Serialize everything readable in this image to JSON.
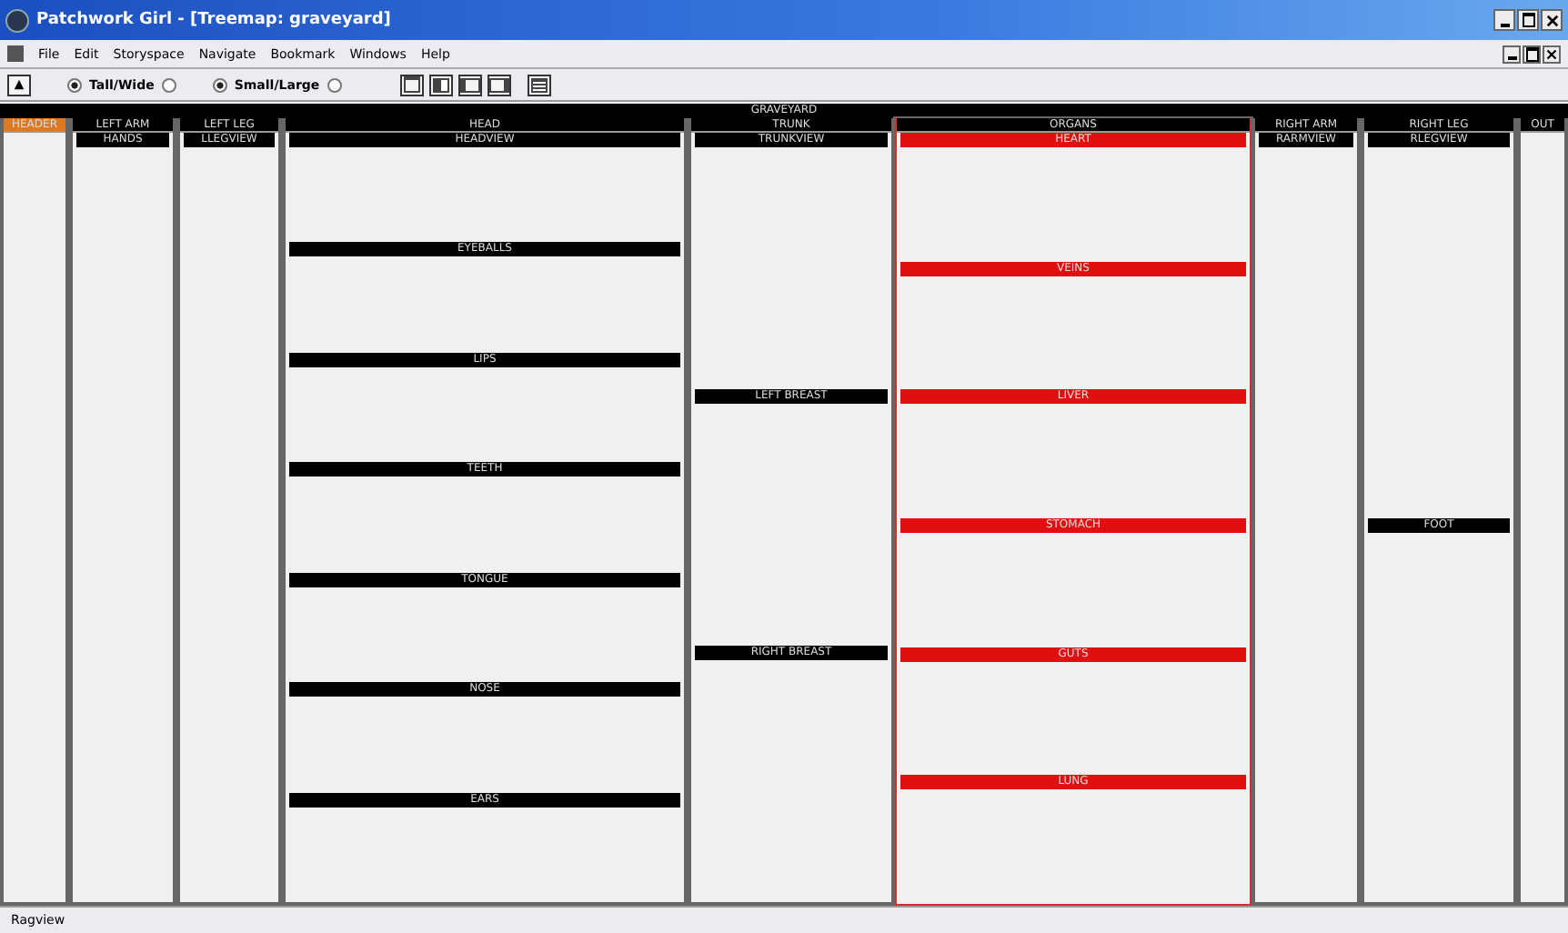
{
  "window": {
    "title": "Patchwork Girl - [Treemap: graveyard]"
  },
  "menu": [
    "File",
    "Edit",
    "Storyspace",
    "Navigate",
    "Bookmark",
    "Windows",
    "Help"
  ],
  "toolbar": {
    "options": [
      {
        "label": "Tall/Wide",
        "selected": true,
        "end_selected": false
      },
      {
        "label": "Small/Large",
        "selected": true,
        "end_selected": false
      }
    ]
  },
  "treemap": {
    "title": "GRAVEYARD",
    "columns": [
      {
        "title": "HEADER",
        "color": "#e07820",
        "selected": false
      },
      {
        "title": "LEFT ARM",
        "color": "#000000",
        "selected": false,
        "sections": [
          {
            "title": "HANDS",
            "color": "#000000"
          }
        ]
      },
      {
        "title": "LEFT LEG",
        "color": "#000000",
        "selected": false,
        "sections": [
          {
            "title": "LLEGVIEW",
            "color": "#000000"
          }
        ]
      },
      {
        "title": "HEAD",
        "color": "#000000",
        "selected": false,
        "sections": [
          {
            "title": "HEADVIEW",
            "color": "#000000"
          },
          {
            "title": "EYEBALLS",
            "color": "#000000"
          },
          {
            "title": "LIPS",
            "color": "#000000"
          },
          {
            "title": "TEETH",
            "color": "#000000"
          },
          {
            "title": "TONGUE",
            "color": "#000000"
          },
          {
            "title": "NOSE",
            "color": "#000000"
          },
          {
            "title": "EARS",
            "color": "#000000"
          }
        ]
      },
      {
        "title": "TRUNK",
        "color": "#000000",
        "selected": false,
        "sections": [
          {
            "title": "TRUNKVIEW",
            "color": "#000000"
          },
          {
            "title": "LEFT BREAST",
            "color": "#000000"
          },
          {
            "title": "RIGHT BREAST",
            "color": "#000000"
          }
        ]
      },
      {
        "title": "ORGANS",
        "color": "#000000",
        "selected": true,
        "sections": [
          {
            "title": "HEART",
            "color": "#e01010"
          },
          {
            "title": "VEINS",
            "color": "#e01010"
          },
          {
            "title": "LIVER",
            "color": "#e01010"
          },
          {
            "title": "STOMACH",
            "color": "#e01010"
          },
          {
            "title": "GUTS",
            "color": "#e01010"
          },
          {
            "title": "LUNG",
            "color": "#e01010"
          }
        ]
      },
      {
        "title": "RIGHT ARM",
        "color": "#000000",
        "selected": false,
        "sections": [
          {
            "title": "RARMVIEW",
            "color": "#000000"
          }
        ]
      },
      {
        "title": "RIGHT LEG",
        "color": "#000000",
        "selected": false,
        "sections": [
          {
            "title": "RLEGVIEW",
            "color": "#000000"
          },
          {
            "title": "FOOT",
            "color": "#000000"
          }
        ]
      },
      {
        "title": "OUT",
        "color": "#000000",
        "selected": false
      }
    ]
  },
  "status_bar": "Ragview"
}
